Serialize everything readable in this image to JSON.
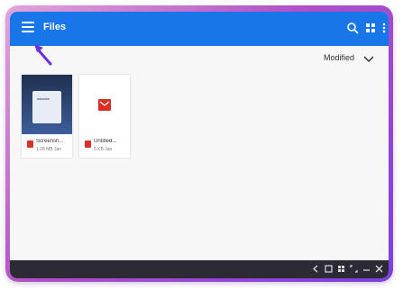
{
  "app": {
    "title": "Files",
    "sort_label": "Modified",
    "menu_icon": "hamburger-menu-icon",
    "search_icon": "search-icon",
    "view_icon": "grid-view-icon",
    "more_icon": "more-vertical-icon"
  },
  "files": [
    {
      "name": "Screensh...",
      "info": "1.28 MB  Jan",
      "type_icon": "image-file-icon",
      "thumb": "screenshot"
    },
    {
      "name": "Untitled...",
      "info": "5 KB  Jan",
      "type_icon": "document-file-icon",
      "thumb": "document"
    }
  ],
  "shelf": {
    "icons": [
      "back-icon",
      "overview-icon",
      "apps-icon",
      "fullscreen-icon",
      "minimize-icon",
      "close-icon"
    ]
  },
  "colors": {
    "appbar": "#1976e8",
    "shelf": "#2b2a35",
    "frame_gradient_start": "#e0a6d9",
    "frame_gradient_end": "#7b3fe0",
    "file_icon_red": "#d93025",
    "pointer_arrow": "#6a2fe0"
  }
}
